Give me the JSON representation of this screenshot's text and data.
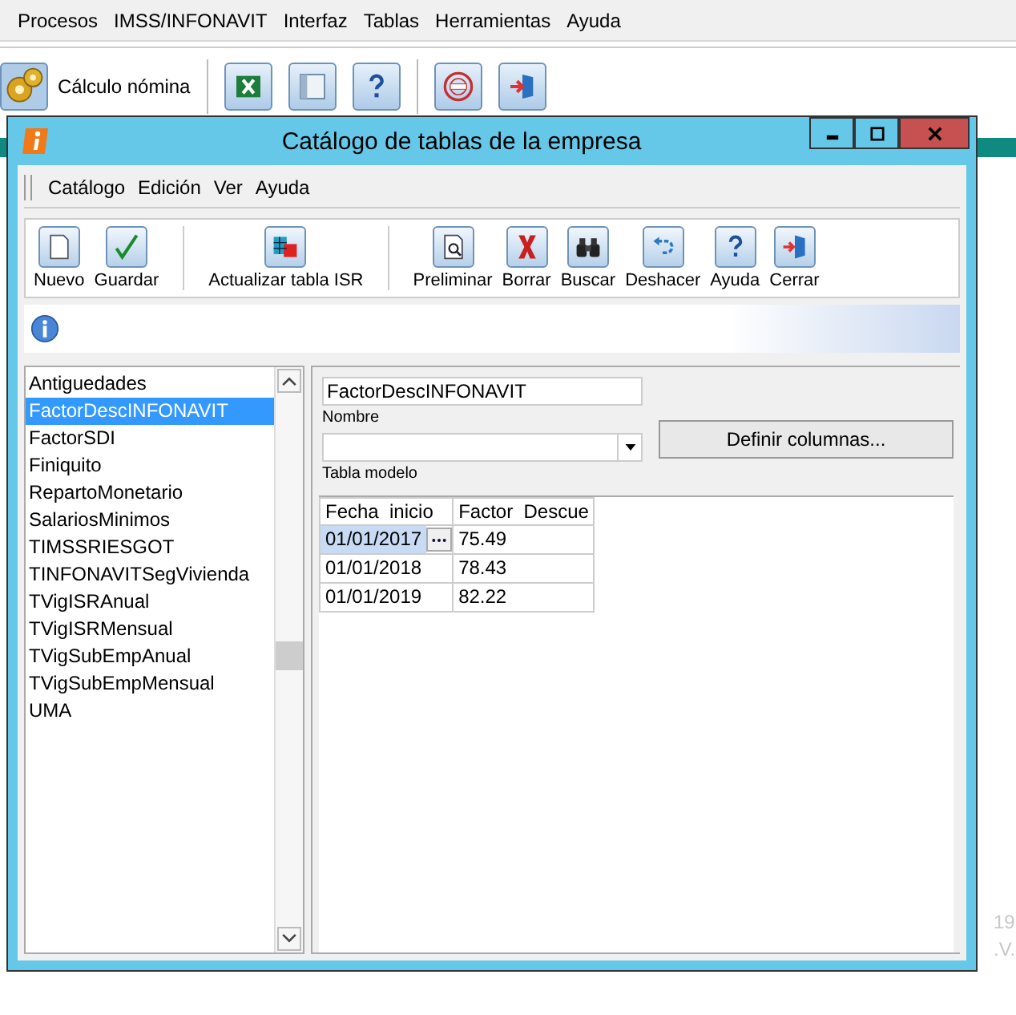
{
  "app_menu": [
    "Procesos",
    "IMSS/INFONAVIT",
    "Interfaz",
    "Tablas",
    "Herramientas",
    "Ayuda"
  ],
  "app_toolbar": {
    "main_button": "Cálculo nómina",
    "buttons": [
      {
        "kind": "excel"
      },
      {
        "kind": "window"
      },
      {
        "kind": "help"
      },
      {
        "kind": "stamp"
      },
      {
        "kind": "exit"
      }
    ]
  },
  "background_texts": [
    "19",
    ".V."
  ],
  "dialog": {
    "title": "Catálogo de tablas de la empresa",
    "menu": [
      "Catálogo",
      "Edición",
      "Ver",
      "Ayuda"
    ],
    "toolbar_groups": [
      [
        {
          "label": "Nuevo",
          "kind": "new"
        },
        {
          "label": "Guardar",
          "kind": "save"
        }
      ],
      [
        {
          "label": "Actualizar tabla ISR",
          "kind": "isr"
        }
      ],
      [
        {
          "label": "Preliminar",
          "kind": "preview"
        },
        {
          "label": "Borrar",
          "kind": "delete"
        },
        {
          "label": "Buscar",
          "kind": "find"
        },
        {
          "label": "Deshacer",
          "kind": "undo"
        },
        {
          "label": "Ayuda",
          "kind": "help"
        },
        {
          "label": "Cerrar",
          "kind": "exit"
        }
      ]
    ],
    "tables": [
      {
        "label": "Antiguedades",
        "selected": false
      },
      {
        "label": "FactorDescINFONAVIT",
        "selected": true
      },
      {
        "label": "FactorSDI",
        "selected": false
      },
      {
        "label": "Finiquito",
        "selected": false
      },
      {
        "label": "RepartoMonetario",
        "selected": false
      },
      {
        "label": "SalariosMinimos",
        "selected": false
      },
      {
        "label": "TIMSSRIESGOT",
        "selected": false
      },
      {
        "label": "TINFONAVITSegVivienda",
        "selected": false
      },
      {
        "label": "TVigISRAnual",
        "selected": false
      },
      {
        "label": "TVigISRMensual",
        "selected": false
      },
      {
        "label": "TVigSubEmpAnual",
        "selected": false
      },
      {
        "label": "TVigSubEmpMensual",
        "selected": false
      },
      {
        "label": "UMA",
        "selected": false
      }
    ],
    "name_field": {
      "value": "FactorDescINFONAVIT",
      "label": "Nombre"
    },
    "model_field": {
      "label": "Tabla modelo"
    },
    "define_button": "Definir columnas...",
    "grid": {
      "columns": [
        "Fecha  inicio",
        "Factor  Descue"
      ],
      "rows": [
        {
          "cells": [
            "01/01/2017",
            "75.49"
          ],
          "selected": true
        },
        {
          "cells": [
            "01/01/2018",
            "78.43"
          ],
          "selected": false
        },
        {
          "cells": [
            "01/01/2019",
            "82.22"
          ],
          "selected": false
        }
      ]
    }
  }
}
